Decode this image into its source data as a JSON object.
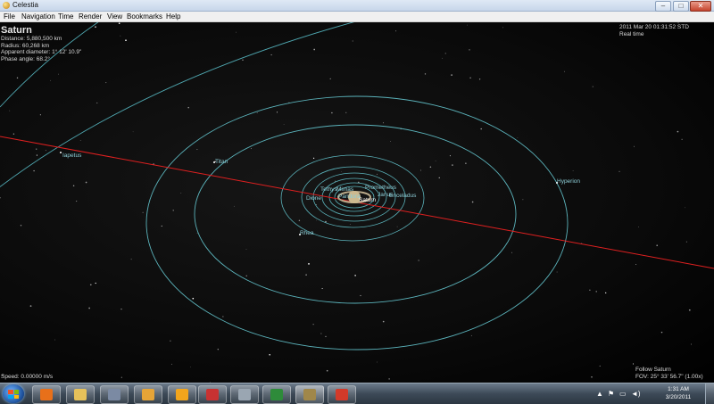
{
  "window": {
    "title": "Celestia",
    "min": "–",
    "max": "□",
    "close": "✕"
  },
  "menu": [
    "File",
    "Navigation",
    "Time",
    "Render",
    "View",
    "Bookmarks",
    "Help"
  ],
  "hud": {
    "object": "Saturn",
    "distance": "Distance: 5,880,500 km",
    "radius": "Radius: 60,268 km",
    "diameter": "Apparent diameter: 1° 12' 10.9\"",
    "phase": "Phase angle: 68.2°",
    "datetime": "2011 Mar 20 01:31:52 STD",
    "realtime": "Real time",
    "speed": "Speed: 0.00000 m/s",
    "follow": "Follow Saturn",
    "fov": "FOV: 25° 33' 56.7\" (1.00x)"
  },
  "moons": {
    "iapetus": "Iapetus",
    "titan": "Titan",
    "hyperion": "Hyperion",
    "rhea": "Rhea",
    "dione": "Dione",
    "tethys": "Tethys",
    "mimas": "Mimas",
    "prometheus": "Prometheus",
    "enceladus": "Enceladus",
    "janus": "Janus",
    "pandora": "Pandora",
    "saturn": "Saturn"
  },
  "taskbar": {
    "apps": [
      {
        "name": "firefox",
        "color": "#e8701a"
      },
      {
        "name": "explorer",
        "color": "#e6c15a"
      },
      {
        "name": "utility",
        "color": "#7b8aa3"
      },
      {
        "name": "media-player",
        "color": "#e6a437"
      },
      {
        "name": "celestia-orb",
        "color": "#f2a51c"
      },
      {
        "name": "acrobat",
        "color": "#c83232"
      },
      {
        "name": "document-viewer",
        "color": "#9aa6b2"
      },
      {
        "name": "excel",
        "color": "#2e8b3a"
      },
      {
        "name": "celestia",
        "color": "#a0874a"
      },
      {
        "name": "powerpoint-red",
        "color": "#d23a2a"
      }
    ],
    "time": "1:31 AM",
    "date": "3/20/2011",
    "tray_expand": "▲",
    "tray_flag": "⚑",
    "tray_network": "▭",
    "tray_volume": "◄)"
  }
}
